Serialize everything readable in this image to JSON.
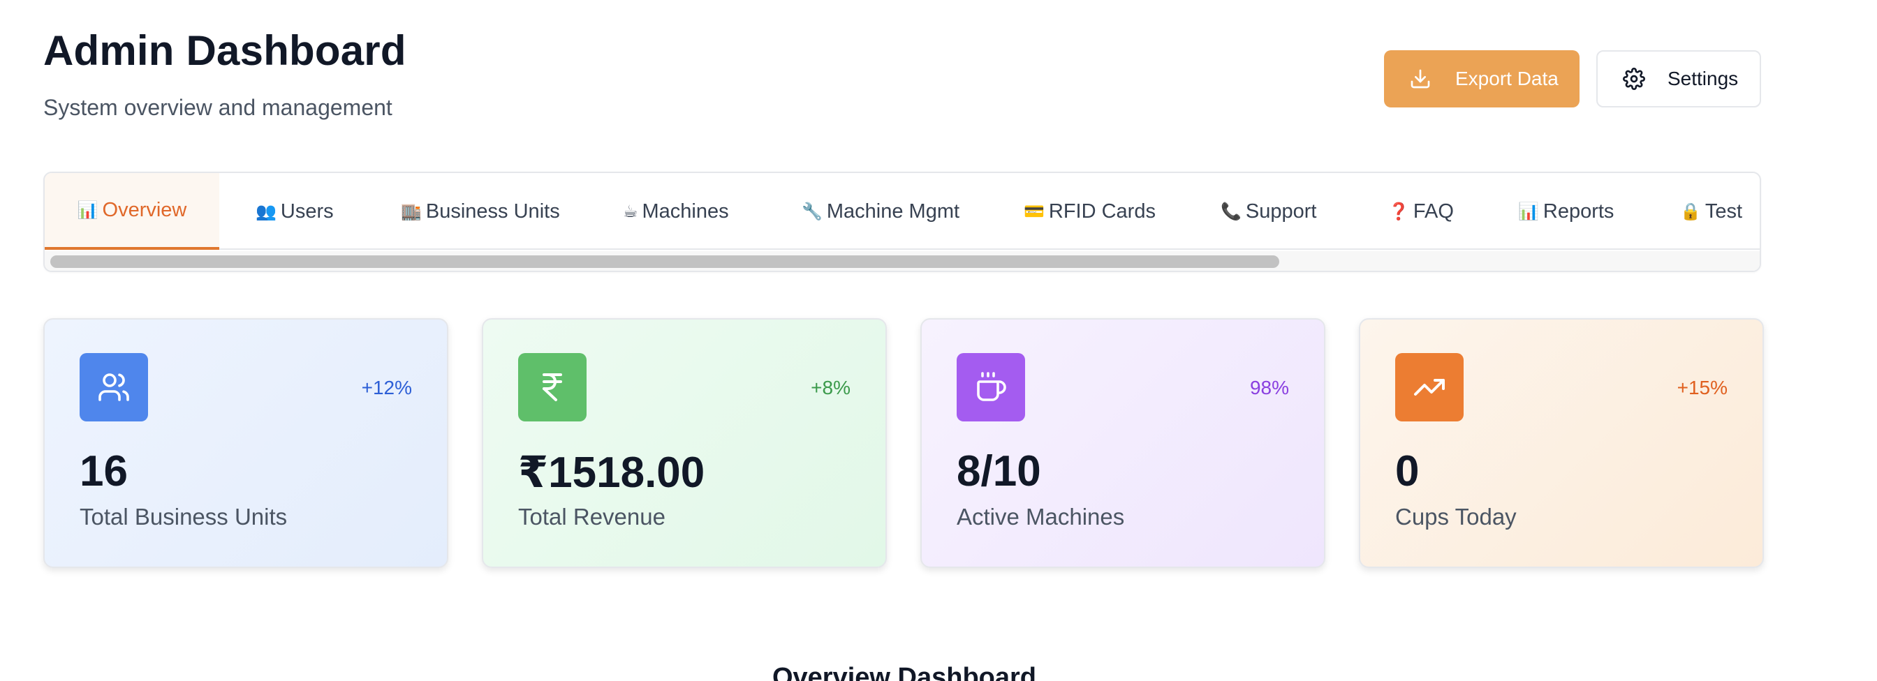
{
  "header": {
    "title": "Admin Dashboard",
    "subtitle": "System overview and management",
    "export_label": "Export Data",
    "settings_label": "Settings"
  },
  "tabs": [
    {
      "icon": "📊",
      "label": "Overview",
      "active": true
    },
    {
      "icon": "👥",
      "label": "Users"
    },
    {
      "icon": "🏬",
      "label": "Business Units"
    },
    {
      "icon": "☕",
      "label": "Machines"
    },
    {
      "icon": "🔧",
      "label": "Machine Mgmt"
    },
    {
      "icon": "💳",
      "label": "RFID Cards"
    },
    {
      "icon": "📞",
      "label": "Support"
    },
    {
      "icon": "❓",
      "label": "FAQ"
    },
    {
      "icon": "📊",
      "label": "Reports"
    },
    {
      "icon": "🔒",
      "label": "Test"
    }
  ],
  "stats": [
    {
      "icon": "users-icon",
      "delta": "+12%",
      "value": "16",
      "label": "Total Business Units",
      "accent": "#4f86ec",
      "delta_color": "#2d5fd6"
    },
    {
      "icon": "rupee-icon",
      "delta": "+8%",
      "value": "₹1518.00",
      "label": "Total Revenue",
      "accent": "#5fbf6a",
      "delta_color": "#3b9a4b"
    },
    {
      "icon": "coffee-cup-icon",
      "delta": "98%",
      "value": "8/10",
      "label": "Active Machines",
      "accent": "#a45cf0",
      "delta_color": "#8a3fe0"
    },
    {
      "icon": "trending-up-icon",
      "delta": "+15%",
      "value": "0",
      "label": "Cups Today",
      "accent": "#ec7d32",
      "delta_color": "#e0601f"
    }
  ],
  "section": {
    "title": "Overview Dashboard"
  },
  "colors": {
    "brand_orange": "#eba355",
    "active_tab": "#e0682a"
  }
}
